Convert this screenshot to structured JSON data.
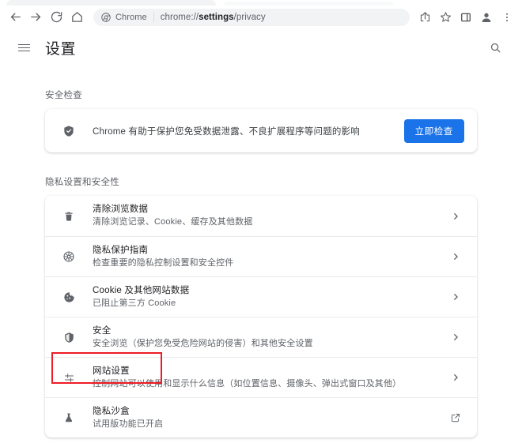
{
  "browser": {
    "nav": {
      "back": "back-arrow",
      "forward": "forward-arrow",
      "reload": "reload",
      "home": "home"
    },
    "omnibox": {
      "site_chip": "Chrome",
      "url_scheme": "chrome://",
      "url_bold": "settings",
      "url_tail": "/privacy",
      "full_url": "chrome://settings/privacy"
    },
    "actions": [
      {
        "name": "share-icon",
        "label": "分享"
      },
      {
        "name": "bookmark-star-icon",
        "label": "收藏"
      },
      {
        "name": "side-panel-icon",
        "label": "侧边栏"
      },
      {
        "name": "profile-avatar-icon",
        "label": "个人资料"
      },
      {
        "name": "more-menu-icon",
        "label": "更多"
      }
    ]
  },
  "settings_header": {
    "menu_label": "主菜单",
    "title": "设置",
    "search_label": "搜索设置"
  },
  "sections": [
    {
      "id": "safety-check",
      "title": "安全检查",
      "card": {
        "icon": "shield-icon",
        "text": "Chrome 有助于保护您免受数据泄露、不良扩展程序等问题的影响",
        "button": "立即检查"
      }
    },
    {
      "id": "privacy-and-security",
      "title": "隐私设置和安全性",
      "rows": [
        {
          "icon": "trash-icon",
          "title": "清除浏览数据",
          "sub": "清除浏览记录、Cookie、缓存及其他数据",
          "end": "chevron-right-icon"
        },
        {
          "icon": "privacy-guide-icon",
          "title": "隐私保护指南",
          "sub": "检查重要的隐私控制设置和安全控件",
          "end": "chevron-right-icon"
        },
        {
          "icon": "cookie-icon",
          "title": "Cookie 及其他网站数据",
          "sub": "已阻止第三方 Cookie",
          "end": "chevron-right-icon"
        },
        {
          "icon": "shield-outline-icon",
          "title": "安全",
          "sub": "安全浏览（保护您免受危险网站的侵害）和其他安全设置",
          "end": "chevron-right-icon"
        },
        {
          "icon": "tune-sliders-icon",
          "title": "网站设置",
          "sub": "控制网站可以使用和显示什么信息（如位置信息、摄像头、弹出式窗口及其他）",
          "end": "chevron-right-icon",
          "highlighted": true
        },
        {
          "icon": "flask-icon",
          "title": "隐私沙盒",
          "sub": "试用版功能已开启",
          "end": "open-in-new-icon"
        }
      ]
    }
  ],
  "annotation": {
    "type": "red-rectangle-highlight",
    "target": "网站设置",
    "color": "#ee1c25"
  },
  "colors": {
    "accent_blue": "#1a73e8",
    "text_primary": "#202124",
    "text_secondary": "#5f6368",
    "omnibox_bg": "#f1f3f4",
    "annotation_red": "#ee1c25"
  }
}
